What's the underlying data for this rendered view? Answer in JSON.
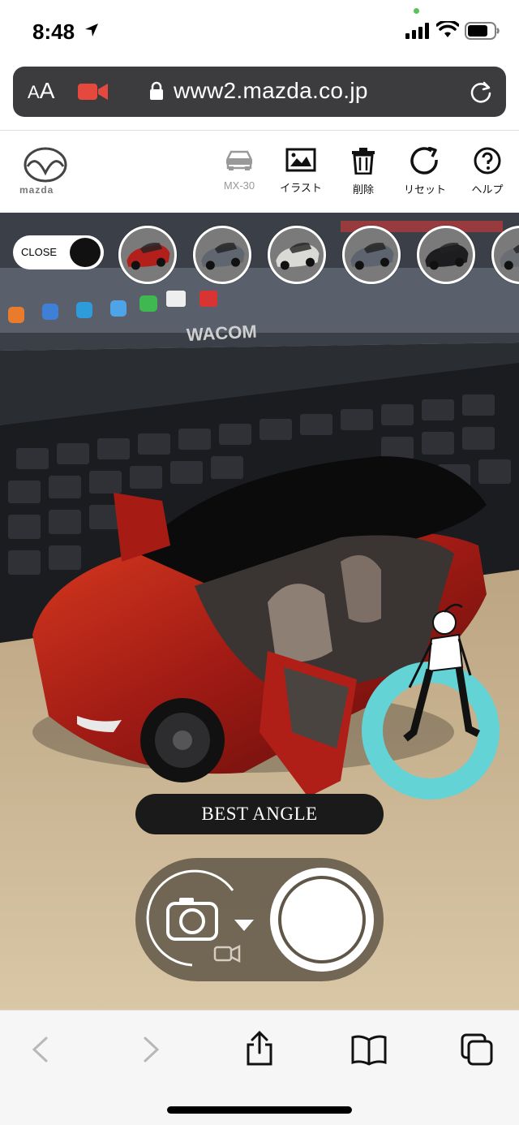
{
  "status": {
    "time": "8:48"
  },
  "browser": {
    "aa_label_small": "A",
    "aa_label_big": "A",
    "url": "www2.mazda.co.jp"
  },
  "site": {
    "logo_text": "mazda",
    "tools": [
      {
        "label": "MX-30",
        "icon": "car-icon",
        "enabled": false
      },
      {
        "label": "イラスト",
        "icon": "picture-icon",
        "enabled": true
      },
      {
        "label": "削除",
        "icon": "trash-icon",
        "enabled": true
      },
      {
        "label": "リセット",
        "icon": "reset-icon",
        "enabled": true
      },
      {
        "label": "ヘルプ",
        "icon": "help-icon",
        "enabled": true
      }
    ]
  },
  "ar": {
    "close_label": "CLOSE",
    "swatch_colors": [
      "#b3201c",
      "#5f6670",
      "#d9d9d6",
      "#5d6470",
      "#1d1d1f",
      "#6a6e73"
    ],
    "background_text": "WACOM",
    "best_angle_label": "BEST ANGLE"
  },
  "colors": {
    "accent_ring": "#63d3d6",
    "car_body": "#b3201c",
    "record_icon": "#e5483c"
  }
}
